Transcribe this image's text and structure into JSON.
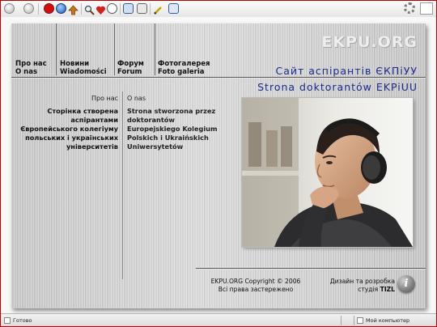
{
  "toolbar": {
    "buttons": [
      "back-icon",
      "forward-icon",
      "stop-icon",
      "home-globe-icon",
      "up-icon",
      "search-icon",
      "favorites-icon",
      "history-icon",
      "mail-icon",
      "print-icon",
      "edit-icon",
      "discuss-icon"
    ]
  },
  "logo": "EKPU.ORG",
  "nav": [
    {
      "ua": "Про нас",
      "pl": "O nas"
    },
    {
      "ua": "Новини",
      "pl": "Wiadomości"
    },
    {
      "ua": "Форум",
      "pl": "Forum"
    },
    {
      "ua": "Фотогалерея",
      "pl": "Foto galeria"
    }
  ],
  "site_title_ua": "Сайт аспірантів ЄКПіУУ",
  "site_title_pl": "Strona doktorantów EKPiUU",
  "section": {
    "ua": "Про нас",
    "pl": "O nas"
  },
  "text_ua": [
    "Сторінка створена",
    "аспірантами",
    "Європейського колегіуму",
    "польських і українських",
    "університетів"
  ],
  "text_pl": [
    "Strona stworzona przez",
    "doktorantów",
    "Europejskiego Kolegium",
    "Polskich i Ukraińskich",
    "Uniwersytetów"
  ],
  "footer": {
    "copyright": "EKPU.ORG Copyright © 2006",
    "rights": "Всі права застережено",
    "design_line1": "Дизайн та розробка",
    "design_studio_prefix": "студія",
    "design_studio": "TIZL",
    "info_glyph": "i"
  },
  "statusbar": {
    "left": "Готово",
    "right": "Мой компьютер"
  },
  "colors": {
    "title_blue": "#1b2a8a",
    "frame_red": "#c00000"
  }
}
